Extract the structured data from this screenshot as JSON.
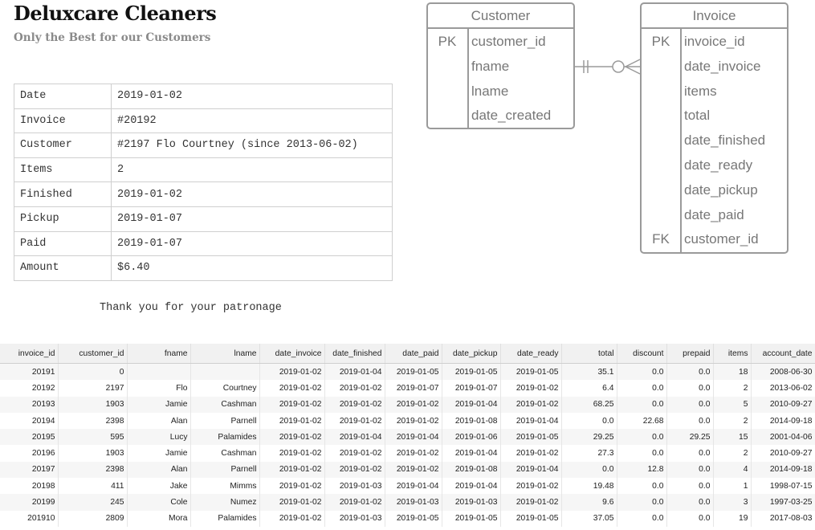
{
  "brand": {
    "title": "Deluxcare Cleaners",
    "subtitle": "Only the Best for our Customers"
  },
  "receipt": {
    "rows": [
      {
        "label": "Date",
        "value": "2019-01-02"
      },
      {
        "label": "Invoice",
        "value": "#20192"
      },
      {
        "label": "Customer",
        "value": "#2197 Flo Courtney (since 2013-06-02)"
      },
      {
        "label": "Items",
        "value": "2"
      },
      {
        "label": "Finished",
        "value": "2019-01-02"
      },
      {
        "label": "Pickup",
        "value": "2019-01-07"
      },
      {
        "label": "Paid",
        "value": "2019-01-07"
      },
      {
        "label": "Amount",
        "value": "$6.40"
      }
    ],
    "thanks": "Thank you for your patronage"
  },
  "erd": {
    "customer": {
      "title": "Customer",
      "fields": [
        {
          "key": "PK",
          "name": "customer_id"
        },
        {
          "key": "",
          "name": "fname"
        },
        {
          "key": "",
          "name": "lname"
        },
        {
          "key": "",
          "name": "date_created"
        }
      ]
    },
    "invoice": {
      "title": "Invoice",
      "fields": [
        {
          "key": "PK",
          "name": "invoice_id"
        },
        {
          "key": "",
          "name": "date_invoice"
        },
        {
          "key": "",
          "name": "items"
        },
        {
          "key": "",
          "name": "total"
        },
        {
          "key": "",
          "name": "date_finished"
        },
        {
          "key": "",
          "name": "date_ready"
        },
        {
          "key": "",
          "name": "date_pickup"
        },
        {
          "key": "",
          "name": "date_paid"
        },
        {
          "key": "FK",
          "name": "customer_id"
        }
      ]
    },
    "relationship": "one-and-only-one to zero-or-many"
  },
  "table": {
    "columns": [
      "invoice_id",
      "customer_id",
      "fname",
      "lname",
      "date_invoice",
      "date_finished",
      "date_paid",
      "date_pickup",
      "date_ready",
      "total",
      "discount",
      "prepaid",
      "items",
      "account_date"
    ],
    "rows": [
      [
        "20191",
        "0",
        "",
        "",
        "2019-01-02",
        "2019-01-04",
        "2019-01-05",
        "2019-01-05",
        "2019-01-05",
        "35.1",
        "0.0",
        "0.0",
        "18",
        "2008-06-30"
      ],
      [
        "20192",
        "2197",
        "Flo",
        "Courtney",
        "2019-01-02",
        "2019-01-02",
        "2019-01-07",
        "2019-01-07",
        "2019-01-02",
        "6.4",
        "0.0",
        "0.0",
        "2",
        "2013-06-02"
      ],
      [
        "20193",
        "1903",
        "Jamie",
        "Cashman",
        "2019-01-02",
        "2019-01-02",
        "2019-01-02",
        "2019-01-04",
        "2019-01-02",
        "68.25",
        "0.0",
        "0.0",
        "5",
        "2010-09-27"
      ],
      [
        "20194",
        "2398",
        "Alan",
        "Parnell",
        "2019-01-02",
        "2019-01-02",
        "2019-01-02",
        "2019-01-08",
        "2019-01-04",
        "0.0",
        "22.68",
        "0.0",
        "2",
        "2014-09-18"
      ],
      [
        "20195",
        "595",
        "Lucy",
        "Palamides",
        "2019-01-02",
        "2019-01-04",
        "2019-01-04",
        "2019-01-06",
        "2019-01-05",
        "29.25",
        "0.0",
        "29.25",
        "15",
        "2001-04-06"
      ],
      [
        "20196",
        "1903",
        "Jamie",
        "Cashman",
        "2019-01-02",
        "2019-01-02",
        "2019-01-02",
        "2019-01-04",
        "2019-01-02",
        "27.3",
        "0.0",
        "0.0",
        "2",
        "2010-09-27"
      ],
      [
        "20197",
        "2398",
        "Alan",
        "Parnell",
        "2019-01-02",
        "2019-01-02",
        "2019-01-02",
        "2019-01-08",
        "2019-01-04",
        "0.0",
        "12.8",
        "0.0",
        "4",
        "2014-09-18"
      ],
      [
        "20198",
        "411",
        "Jake",
        "Mimms",
        "2019-01-02",
        "2019-01-03",
        "2019-01-04",
        "2019-01-04",
        "2019-01-02",
        "19.48",
        "0.0",
        "0.0",
        "1",
        "1998-07-15"
      ],
      [
        "20199",
        "245",
        "Cole",
        "Numez",
        "2019-01-02",
        "2019-01-02",
        "2019-01-03",
        "2019-01-03",
        "2019-01-02",
        "9.6",
        "0.0",
        "0.0",
        "3",
        "1997-03-25"
      ],
      [
        "201910",
        "2809",
        "Mora",
        "Palamides",
        "2019-01-02",
        "2019-01-03",
        "2019-01-05",
        "2019-01-05",
        "2019-01-05",
        "37.05",
        "0.0",
        "0.0",
        "19",
        "2017-08-03"
      ]
    ]
  }
}
